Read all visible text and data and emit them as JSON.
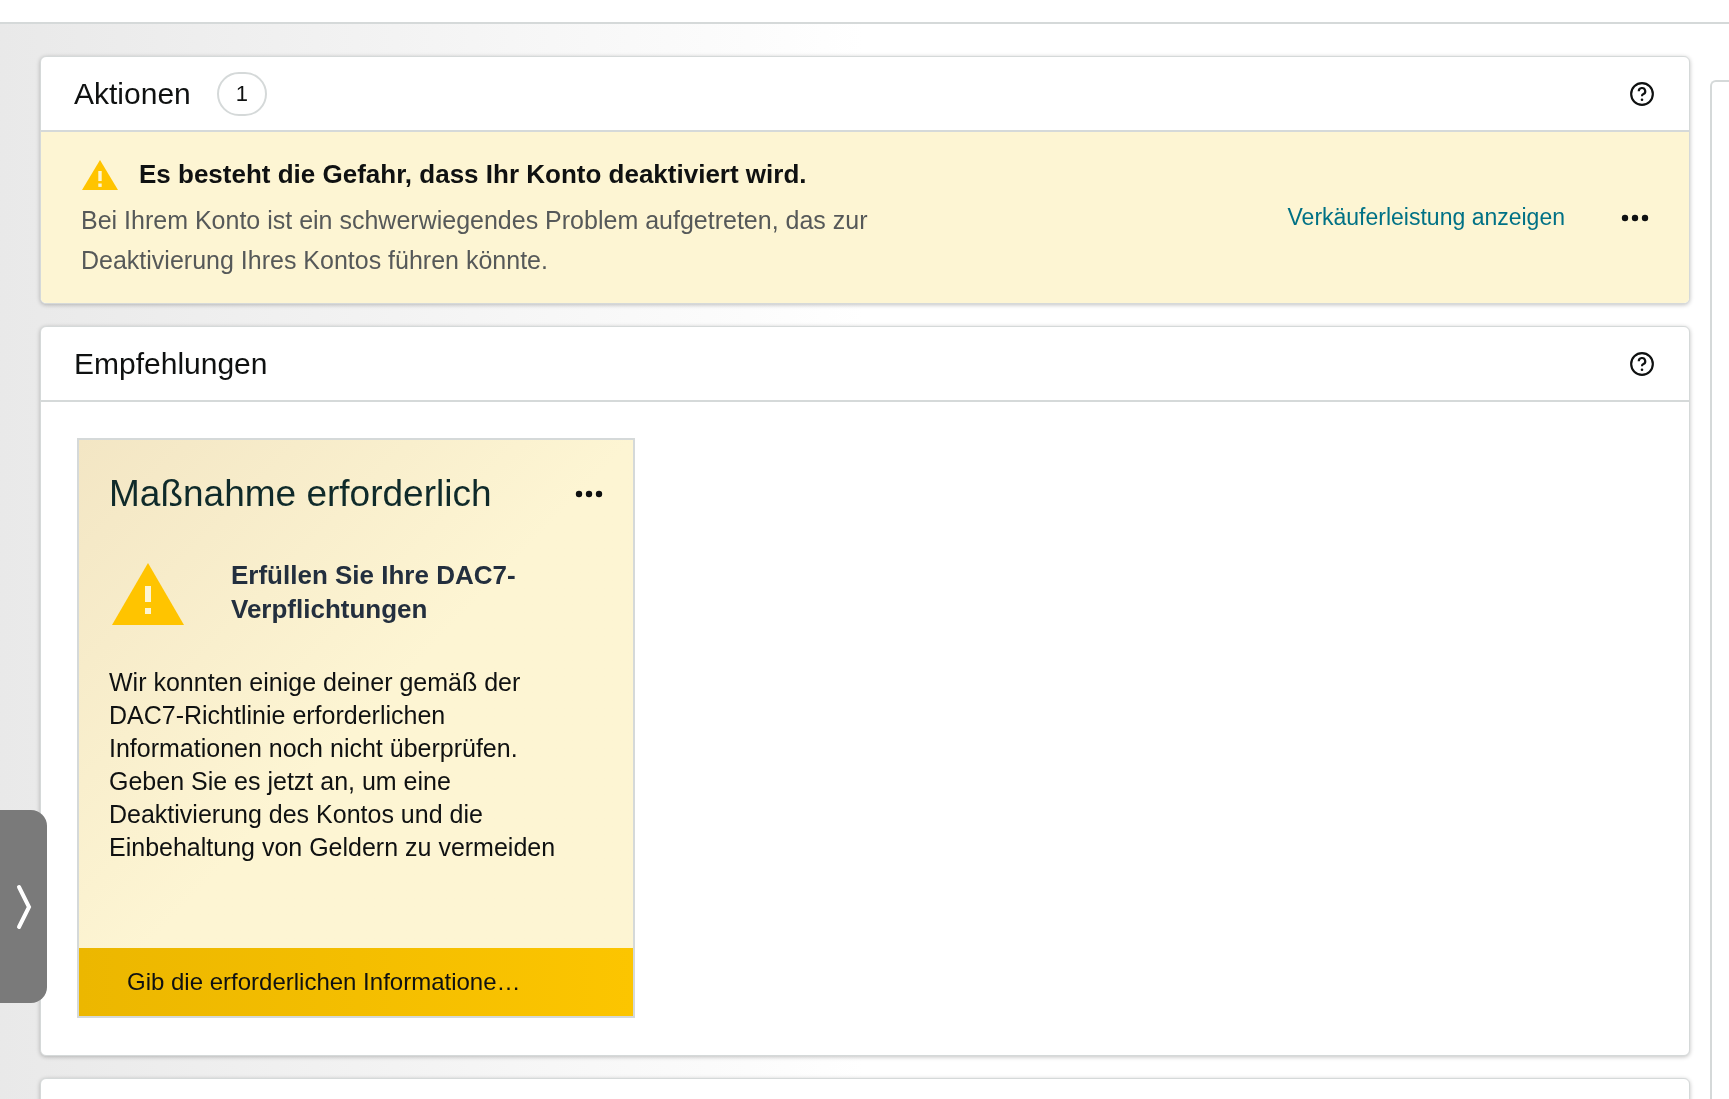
{
  "actions": {
    "title": "Aktionen",
    "count": "1",
    "alert": {
      "title": "Es besteht die Gefahr, dass Ihr Konto deaktiviert wird.",
      "message": "Bei Ihrem Konto ist ein schwerwiegendes Problem aufgetreten, das zur Deaktivierung Ihres Kontos führen könnte.",
      "link": "Verkäuferleistung anzeigen"
    }
  },
  "recommendations": {
    "title": "Empfehlungen",
    "cards": [
      {
        "status": "Maßnahme erforderlich",
        "heading": "Erfüllen Sie Ihre DAC7-Verpflichtungen",
        "body": "Wir konnten einige deiner gemäß der DAC7-Richtlinie erforderlichen Informationen noch nicht überprüfen. Geben Sie es jetzt an, um eine Deaktivierung des Kontos und die Einbehaltung von Geldern zu vermeiden",
        "button": "Gib die erforderlichen Informatione…"
      }
    ]
  }
}
